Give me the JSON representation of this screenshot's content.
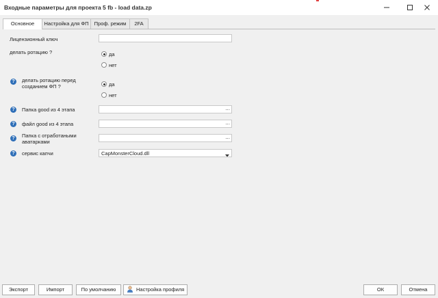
{
  "window": {
    "title": "Входные параметры для проекта 5 fb - load data.zp",
    "controls": {
      "minimize": "minimize-icon",
      "maximize": "maximize-icon",
      "close": "close-icon"
    }
  },
  "tabs": [
    {
      "label": "Основное",
      "active": true
    },
    {
      "label": "Настройка для ФП",
      "active": false
    },
    {
      "label": "Проф. режим",
      "active": false
    },
    {
      "label": "2FA",
      "active": false
    }
  ],
  "form": {
    "license_key": {
      "label": "Лицензионный ключ",
      "value": ""
    },
    "rotation": {
      "label": "делать ротацию ?",
      "options": [
        {
          "label": "да",
          "checked": true
        },
        {
          "label": "нет",
          "checked": false
        }
      ]
    },
    "rotation_before": {
      "label": "делать ротацию перед созданием ФП ?",
      "options": [
        {
          "label": "да",
          "checked": true
        },
        {
          "label": "нет",
          "checked": false
        }
      ]
    },
    "good_folder": {
      "label": "Папка good из 4 этапа",
      "value": "",
      "button": "..."
    },
    "good_file": {
      "label": "файл good из 4 этапа",
      "value": "",
      "button": "..."
    },
    "processed_avatars": {
      "label": "Папка с отработаными аватарками",
      "value": "",
      "button": "..."
    },
    "captcha_service": {
      "label": "сервис капчи",
      "value": "CapMonsterCloud.dll"
    }
  },
  "buttons": {
    "export": "Экспорт",
    "import": "Импорт",
    "default": "По умолчанию",
    "profile": "Настройка профиля",
    "ok": "ОК",
    "cancel": "Отмена"
  },
  "colors": {
    "help_icon": "#2f6fb8",
    "background": "#f0f0f0"
  }
}
